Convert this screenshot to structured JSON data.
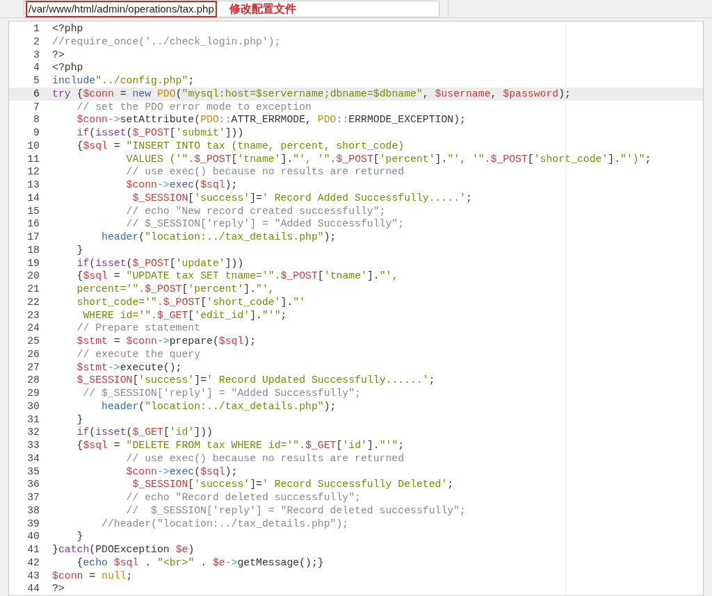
{
  "path_bar": {
    "path": "/var/www/html/admin/operations/tax.php",
    "path_highlighted": true,
    "annotation": "修改配置文件"
  },
  "editor": {
    "lines": [
      {
        "number": "1",
        "current": false,
        "kind": "flush",
        "tokens": [
          {
            "kind": "txt",
            "text": "<?php"
          }
        ]
      },
      {
        "number": "2",
        "current": false,
        "kind": "flush",
        "tokens": [
          {
            "kind": "cmt",
            "text": "//require_once('../check_login.php');"
          }
        ]
      },
      {
        "number": "3",
        "current": false,
        "kind": "flush",
        "tokens": [
          {
            "kind": "txt",
            "text": "?>"
          }
        ]
      },
      {
        "number": "4",
        "current": false,
        "kind": "flush",
        "tokens": [
          {
            "kind": "txt",
            "text": "<?php"
          }
        ]
      },
      {
        "number": "5",
        "current": false,
        "kind": "flush",
        "tokens": [
          {
            "kind": "fn",
            "text": "include"
          },
          {
            "kind": "str",
            "text": "\"../config.php\""
          },
          {
            "kind": "txt",
            "text": ";"
          }
        ]
      },
      {
        "number": "6",
        "current": true,
        "kind": "flush",
        "tokens": [
          {
            "kind": "kw",
            "text": "try"
          },
          {
            "kind": "txt",
            "text": " {"
          },
          {
            "kind": "var",
            "text": "$conn"
          },
          {
            "kind": "txt",
            "text": " = "
          },
          {
            "kind": "fn",
            "text": "new"
          },
          {
            "kind": "cls",
            "text": " PDO"
          },
          {
            "kind": "txt",
            "text": "("
          },
          {
            "kind": "str",
            "text": "\"mysql:host=$servername;dbname=$dbname\""
          },
          {
            "kind": "txt",
            "text": ", "
          },
          {
            "kind": "var",
            "text": "$username"
          },
          {
            "kind": "txt",
            "text": ", "
          },
          {
            "kind": "var",
            "text": "$password"
          },
          {
            "kind": "txt",
            "text": ");"
          }
        ]
      },
      {
        "number": "7",
        "current": false,
        "kind": "indent4",
        "tokens": [
          {
            "kind": "cmt",
            "text": "// set the PDO error mode to exception"
          }
        ]
      },
      {
        "number": "8",
        "current": false,
        "kind": "indent4",
        "tokens": [
          {
            "kind": "var",
            "text": "$conn"
          },
          {
            "kind": "op",
            "text": "->"
          },
          {
            "kind": "txt",
            "text": "setAttribute("
          },
          {
            "kind": "cls",
            "text": "PDO"
          },
          {
            "kind": "op",
            "text": "::"
          },
          {
            "kind": "txt",
            "text": "ATTR_ERRMODE, "
          },
          {
            "kind": "cls",
            "text": "PDO"
          },
          {
            "kind": "op",
            "text": "::"
          },
          {
            "kind": "txt",
            "text": "ERRMODE_EXCEPTION);"
          }
        ]
      },
      {
        "number": "9",
        "current": false,
        "kind": "indent4",
        "tokens": [
          {
            "kind": "kw",
            "text": "if"
          },
          {
            "kind": "txt",
            "text": "("
          },
          {
            "kind": "kw",
            "text": "isset"
          },
          {
            "kind": "txt",
            "text": "("
          },
          {
            "kind": "var",
            "text": "$_POST"
          },
          {
            "kind": "txt",
            "text": "["
          },
          {
            "kind": "str",
            "text": "'submit'"
          },
          {
            "kind": "txt",
            "text": "]))"
          }
        ]
      },
      {
        "number": "10",
        "current": false,
        "kind": "indent4",
        "tokens": [
          {
            "kind": "txt",
            "text": "{"
          },
          {
            "kind": "var",
            "text": "$sql"
          },
          {
            "kind": "txt",
            "text": " = "
          },
          {
            "kind": "str",
            "text": "\"INSERT INTO tax (tname, percent, short_code)"
          }
        ]
      },
      {
        "number": "11",
        "current": false,
        "kind": "indent12",
        "tokens": [
          {
            "kind": "str",
            "text": "VALUES ('\"."
          },
          {
            "kind": "var",
            "text": "$_POST"
          },
          {
            "kind": "txt",
            "text": "["
          },
          {
            "kind": "str",
            "text": "'tname'"
          },
          {
            "kind": "txt",
            "text": "]."
          },
          {
            "kind": "str",
            "text": "\"', '\"."
          },
          {
            "kind": "var",
            "text": "$_POST"
          },
          {
            "kind": "txt",
            "text": "["
          },
          {
            "kind": "str",
            "text": "'percent'"
          },
          {
            "kind": "txt",
            "text": "]."
          },
          {
            "kind": "str",
            "text": "\"', '\"."
          },
          {
            "kind": "var",
            "text": "$_POST"
          },
          {
            "kind": "txt",
            "text": "["
          },
          {
            "kind": "str",
            "text": "'short_code'"
          },
          {
            "kind": "txt",
            "text": "]."
          },
          {
            "kind": "str",
            "text": "\"')\""
          },
          {
            "kind": "txt",
            "text": ";"
          }
        ]
      },
      {
        "number": "12",
        "current": false,
        "kind": "indent12",
        "tokens": [
          {
            "kind": "cmt",
            "text": "// use exec() because no results are returned"
          }
        ]
      },
      {
        "number": "13",
        "current": false,
        "kind": "indent12",
        "tokens": [
          {
            "kind": "var",
            "text": "$conn"
          },
          {
            "kind": "op",
            "text": "->"
          },
          {
            "kind": "fn",
            "text": "exec"
          },
          {
            "kind": "txt",
            "text": "("
          },
          {
            "kind": "var",
            "text": "$sql"
          },
          {
            "kind": "txt",
            "text": ");"
          }
        ]
      },
      {
        "number": "14",
        "current": false,
        "kind": "indent13",
        "tokens": [
          {
            "kind": "var",
            "text": "$_SESSION"
          },
          {
            "kind": "txt",
            "text": "["
          },
          {
            "kind": "str",
            "text": "'success'"
          },
          {
            "kind": "txt",
            "text": "]="
          },
          {
            "kind": "str",
            "text": "' Record Added Successfully.....'"
          },
          {
            "kind": "txt",
            "text": ";"
          }
        ]
      },
      {
        "number": "15",
        "current": false,
        "kind": "indent12",
        "tokens": [
          {
            "kind": "cmt",
            "text": "// echo \"New record created successfully\";"
          }
        ]
      },
      {
        "number": "16",
        "current": false,
        "kind": "indent12",
        "tokens": [
          {
            "kind": "cmt",
            "text": "// $_SESSION['reply'] = \"Added Successfully\";"
          }
        ]
      },
      {
        "number": "17",
        "current": false,
        "kind": "indent8",
        "tokens": [
          {
            "kind": "fn",
            "text": "header"
          },
          {
            "kind": "txt",
            "text": "("
          },
          {
            "kind": "str",
            "text": "\"location:../tax_details.php\""
          },
          {
            "kind": "txt",
            "text": ");"
          }
        ]
      },
      {
        "number": "18",
        "current": false,
        "kind": "indent4",
        "tokens": [
          {
            "kind": "txt",
            "text": "}"
          }
        ]
      },
      {
        "number": "19",
        "current": false,
        "kind": "indent4",
        "tokens": [
          {
            "kind": "kw",
            "text": "if"
          },
          {
            "kind": "txt",
            "text": "("
          },
          {
            "kind": "kw",
            "text": "isset"
          },
          {
            "kind": "txt",
            "text": "("
          },
          {
            "kind": "var",
            "text": "$_POST"
          },
          {
            "kind": "txt",
            "text": "["
          },
          {
            "kind": "str",
            "text": "'update'"
          },
          {
            "kind": "txt",
            "text": "]))"
          }
        ]
      },
      {
        "number": "20",
        "current": false,
        "kind": "indent4",
        "tokens": [
          {
            "kind": "txt",
            "text": "{"
          },
          {
            "kind": "var",
            "text": "$sql"
          },
          {
            "kind": "txt",
            "text": " = "
          },
          {
            "kind": "str",
            "text": "\"UPDATE tax SET tname='\"."
          },
          {
            "kind": "var",
            "text": "$_POST"
          },
          {
            "kind": "txt",
            "text": "["
          },
          {
            "kind": "str",
            "text": "'tname'"
          },
          {
            "kind": "txt",
            "text": "]."
          },
          {
            "kind": "str",
            "text": "\"',"
          }
        ]
      },
      {
        "number": "21",
        "current": false,
        "kind": "indent4",
        "tokens": [
          {
            "kind": "str",
            "text": "percent='\"."
          },
          {
            "kind": "var",
            "text": "$_POST"
          },
          {
            "kind": "txt",
            "text": "["
          },
          {
            "kind": "str",
            "text": "'percent'"
          },
          {
            "kind": "txt",
            "text": "]."
          },
          {
            "kind": "str",
            "text": "\"',"
          }
        ]
      },
      {
        "number": "22",
        "current": false,
        "kind": "indent4",
        "tokens": [
          {
            "kind": "str",
            "text": "short_code='\"."
          },
          {
            "kind": "var",
            "text": "$_POST"
          },
          {
            "kind": "txt",
            "text": "["
          },
          {
            "kind": "str",
            "text": "'short_code'"
          },
          {
            "kind": "txt",
            "text": "]."
          },
          {
            "kind": "str",
            "text": "\"'"
          }
        ]
      },
      {
        "number": "23",
        "current": false,
        "kind": "indent5",
        "tokens": [
          {
            "kind": "str",
            "text": "WHERE id='\"."
          },
          {
            "kind": "var",
            "text": "$_GET"
          },
          {
            "kind": "txt",
            "text": "["
          },
          {
            "kind": "str",
            "text": "'edit_id'"
          },
          {
            "kind": "txt",
            "text": "]."
          },
          {
            "kind": "str",
            "text": "\"'\""
          },
          {
            "kind": "txt",
            "text": ";"
          }
        ]
      },
      {
        "number": "24",
        "current": false,
        "kind": "indent4",
        "tokens": [
          {
            "kind": "cmt",
            "text": "// Prepare statement"
          }
        ]
      },
      {
        "number": "25",
        "current": false,
        "kind": "indent4",
        "tokens": [
          {
            "kind": "var",
            "text": "$stmt"
          },
          {
            "kind": "txt",
            "text": " = "
          },
          {
            "kind": "var",
            "text": "$conn"
          },
          {
            "kind": "op",
            "text": "->"
          },
          {
            "kind": "txt",
            "text": "prepare("
          },
          {
            "kind": "var",
            "text": "$sql"
          },
          {
            "kind": "txt",
            "text": ");"
          }
        ]
      },
      {
        "number": "26",
        "current": false,
        "kind": "indent4",
        "tokens": [
          {
            "kind": "cmt",
            "text": "// execute the query"
          }
        ]
      },
      {
        "number": "27",
        "current": false,
        "kind": "indent4",
        "tokens": [
          {
            "kind": "var",
            "text": "$stmt"
          },
          {
            "kind": "op",
            "text": "->"
          },
          {
            "kind": "txt",
            "text": "execute();"
          }
        ]
      },
      {
        "number": "28",
        "current": false,
        "kind": "indent4",
        "tokens": [
          {
            "kind": "var",
            "text": "$_SESSION"
          },
          {
            "kind": "txt",
            "text": "["
          },
          {
            "kind": "str",
            "text": "'success'"
          },
          {
            "kind": "txt",
            "text": "]="
          },
          {
            "kind": "str",
            "text": "' Record Updated Successfully......'"
          },
          {
            "kind": "txt",
            "text": ";"
          }
        ]
      },
      {
        "number": "29",
        "current": false,
        "kind": "indent5",
        "tokens": [
          {
            "kind": "cmt",
            "text": "// $_SESSION['reply'] = \"Added Successfully\";"
          }
        ]
      },
      {
        "number": "30",
        "current": false,
        "kind": "indent8",
        "tokens": [
          {
            "kind": "fn",
            "text": "header"
          },
          {
            "kind": "txt",
            "text": "("
          },
          {
            "kind": "str",
            "text": "\"location:../tax_details.php\""
          },
          {
            "kind": "txt",
            "text": ");"
          }
        ]
      },
      {
        "number": "31",
        "current": false,
        "kind": "indent4",
        "tokens": [
          {
            "kind": "txt",
            "text": "}"
          }
        ]
      },
      {
        "number": "32",
        "current": false,
        "kind": "indent4",
        "tokens": [
          {
            "kind": "kw",
            "text": "if"
          },
          {
            "kind": "txt",
            "text": "("
          },
          {
            "kind": "kw",
            "text": "isset"
          },
          {
            "kind": "txt",
            "text": "("
          },
          {
            "kind": "var",
            "text": "$_GET"
          },
          {
            "kind": "txt",
            "text": "["
          },
          {
            "kind": "str",
            "text": "'id'"
          },
          {
            "kind": "txt",
            "text": "]))"
          }
        ]
      },
      {
        "number": "33",
        "current": false,
        "kind": "indent4",
        "tokens": [
          {
            "kind": "txt",
            "text": "{"
          },
          {
            "kind": "var",
            "text": "$sql"
          },
          {
            "kind": "txt",
            "text": " = "
          },
          {
            "kind": "str",
            "text": "\"DELETE FROM tax WHERE id='\"."
          },
          {
            "kind": "var",
            "text": "$_GET"
          },
          {
            "kind": "txt",
            "text": "["
          },
          {
            "kind": "str",
            "text": "'id'"
          },
          {
            "kind": "txt",
            "text": "]."
          },
          {
            "kind": "str",
            "text": "\"'\""
          },
          {
            "kind": "txt",
            "text": ";"
          }
        ]
      },
      {
        "number": "34",
        "current": false,
        "kind": "indent12",
        "tokens": [
          {
            "kind": "cmt",
            "text": "// use exec() because no results are returned"
          }
        ]
      },
      {
        "number": "35",
        "current": false,
        "kind": "indent12",
        "tokens": [
          {
            "kind": "var",
            "text": "$conn"
          },
          {
            "kind": "op",
            "text": "->"
          },
          {
            "kind": "fn",
            "text": "exec"
          },
          {
            "kind": "txt",
            "text": "("
          },
          {
            "kind": "var",
            "text": "$sql"
          },
          {
            "kind": "txt",
            "text": ");"
          }
        ]
      },
      {
        "number": "36",
        "current": false,
        "kind": "indent13",
        "tokens": [
          {
            "kind": "var",
            "text": "$_SESSION"
          },
          {
            "kind": "txt",
            "text": "["
          },
          {
            "kind": "str",
            "text": "'success'"
          },
          {
            "kind": "txt",
            "text": "]="
          },
          {
            "kind": "str",
            "text": "' Record Successfully Deleted'"
          },
          {
            "kind": "txt",
            "text": ";"
          }
        ]
      },
      {
        "number": "37",
        "current": false,
        "kind": "indent12",
        "tokens": [
          {
            "kind": "cmt",
            "text": "// echo \"Record deleted successfully\";"
          }
        ]
      },
      {
        "number": "38",
        "current": false,
        "kind": "indent12",
        "tokens": [
          {
            "kind": "cmt",
            "text": "//  $_SESSION['reply'] = \"Record deleted successfully\";"
          }
        ]
      },
      {
        "number": "39",
        "current": false,
        "kind": "indent8",
        "tokens": [
          {
            "kind": "cmt",
            "text": "//header(\"location:../tax_details.php\");"
          }
        ]
      },
      {
        "number": "40",
        "current": false,
        "kind": "indent4",
        "tokens": [
          {
            "kind": "txt",
            "text": "}"
          }
        ]
      },
      {
        "number": "41",
        "current": false,
        "kind": "flush",
        "tokens": [
          {
            "kind": "txt",
            "text": "}"
          },
          {
            "kind": "kw",
            "text": "catch"
          },
          {
            "kind": "txt",
            "text": "(PDOException "
          },
          {
            "kind": "var",
            "text": "$e"
          },
          {
            "kind": "txt",
            "text": ")"
          }
        ]
      },
      {
        "number": "42",
        "current": false,
        "kind": "indent4",
        "tokens": [
          {
            "kind": "txt",
            "text": "{"
          },
          {
            "kind": "fn",
            "text": "echo"
          },
          {
            "kind": "var",
            "text": " $sql"
          },
          {
            "kind": "txt",
            "text": " . "
          },
          {
            "kind": "str",
            "text": "\"<br>\""
          },
          {
            "kind": "txt",
            "text": " . "
          },
          {
            "kind": "var",
            "text": "$e"
          },
          {
            "kind": "op",
            "text": "->"
          },
          {
            "kind": "txt",
            "text": "getMessage();}"
          }
        ]
      },
      {
        "number": "43",
        "current": false,
        "kind": "flush",
        "tokens": [
          {
            "kind": "var",
            "text": "$conn"
          },
          {
            "kind": "txt",
            "text": " = "
          },
          {
            "kind": "cls",
            "text": "null"
          },
          {
            "kind": "txt",
            "text": ";"
          }
        ]
      },
      {
        "number": "44",
        "current": false,
        "kind": "flush",
        "tokens": [
          {
            "kind": "txt",
            "text": "?>"
          }
        ]
      }
    ]
  }
}
